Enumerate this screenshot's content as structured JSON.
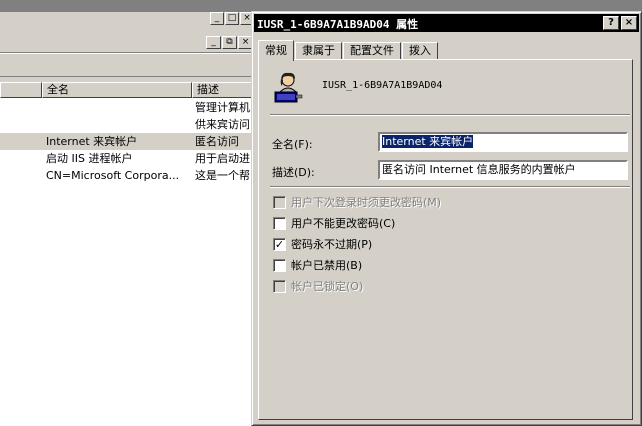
{
  "background_window": {
    "outer_controls": [
      "_",
      "□",
      "×"
    ],
    "inner_controls": [
      "_",
      "⧉",
      "×"
    ],
    "columns": [
      "全名",
      "描述"
    ],
    "rows": [
      {
        "name": "",
        "desc": "管理计算机"
      },
      {
        "name": "",
        "desc": "供来宾访问"
      },
      {
        "name": "Internet 来宾帐户",
        "desc": "匿名访问",
        "selected": true
      },
      {
        "name": "启动 IIS 进程帐户",
        "desc": "用于启动进"
      },
      {
        "name": "CN=Microsoft Corpora...",
        "desc": "这是一个帮"
      }
    ]
  },
  "dialog": {
    "title": "IUSR_1-6B9A7A1B9AD04 属性",
    "help_button": "?",
    "close_button": "×",
    "tabs": [
      "常规",
      "隶属于",
      "配置文件",
      "拨入"
    ],
    "active_tab": "常规",
    "username": "IUSR_1-6B9A7A1B9AD04",
    "user_icon": "user-account-icon",
    "fullname_label": "全名(F):",
    "fullname_value": "Internet 来宾帐户",
    "description_label": "描述(D):",
    "description_value": "匿名访问 Internet 信息服务的内置帐户",
    "options": [
      {
        "label": "用户下次登录时须更改密码(M)",
        "checked": false,
        "disabled": true
      },
      {
        "label": "用户不能更改密码(C)",
        "checked": false,
        "disabled": false
      },
      {
        "label": "密码永不过期(P)",
        "checked": true,
        "disabled": false
      },
      {
        "label": "帐户已禁用(B)",
        "checked": false,
        "disabled": false
      },
      {
        "label": "帐户已锁定(O)",
        "checked": false,
        "disabled": true
      }
    ]
  }
}
